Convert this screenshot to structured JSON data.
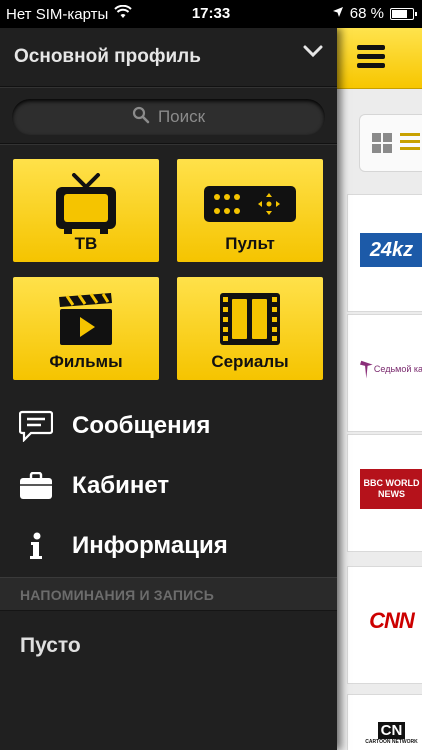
{
  "status_bar": {
    "carrier": "Нет SIM-карты",
    "time": "17:33",
    "battery_text": "68 %",
    "battery_level": 0.68
  },
  "menu": {
    "profile_title": "Основной профиль",
    "search_placeholder": "Поиск",
    "tiles": [
      {
        "label": "ТВ",
        "icon": "tv-icon"
      },
      {
        "label": "Пульт",
        "icon": "remote-icon"
      },
      {
        "label": "Фильмы",
        "icon": "clapperboard-icon"
      },
      {
        "label": "Сериалы",
        "icon": "film-strip-icon"
      }
    ],
    "items": [
      {
        "label": "Сообщения",
        "icon": "message-icon"
      },
      {
        "label": "Кабинет",
        "icon": "briefcase-icon"
      },
      {
        "label": "Информация",
        "icon": "info-icon"
      }
    ],
    "section_header": "НАПОМИНАНИЯ И ЗАПИСЬ",
    "empty_text": "Пусто"
  },
  "content": {
    "channels": [
      {
        "logo_text": "24kz",
        "name": "24kz"
      },
      {
        "logo_text": "Седьмой ка",
        "name": "Седьмой канал"
      },
      {
        "logo_text": "BBC WORLD NEWS",
        "name": "BBC World News"
      },
      {
        "logo_text": "CNN",
        "name": "CNN"
      },
      {
        "logo_text": "CN",
        "logo_subtext": "CARTOON NETWORK",
        "name": "Cartoon Network"
      }
    ]
  },
  "colors": {
    "accent_yellow": "#f7c600",
    "menu_bg": "#202020",
    "cnn_red": "#cc0000",
    "bbc_red": "#b5121b",
    "kz_blue": "#1c5aa8"
  }
}
